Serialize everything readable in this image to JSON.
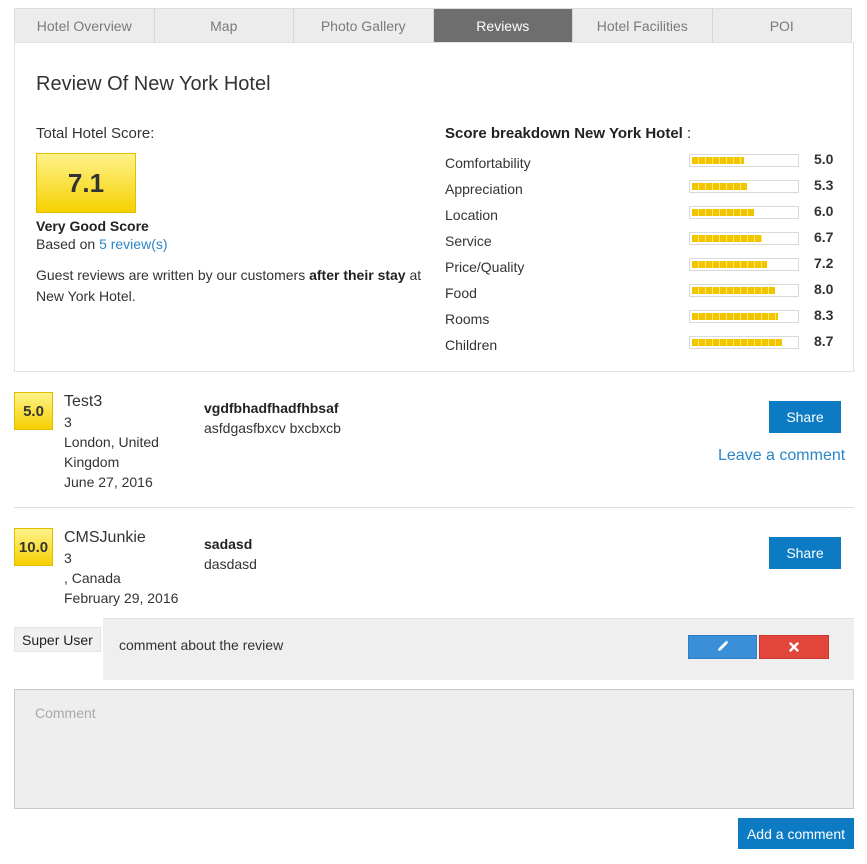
{
  "tabs": [
    {
      "label": "Hotel Overview",
      "active": false
    },
    {
      "label": "Map",
      "active": false
    },
    {
      "label": "Photo Gallery",
      "active": false
    },
    {
      "label": "Reviews",
      "active": true
    },
    {
      "label": "Hotel Facilities",
      "active": false
    },
    {
      "label": "POI",
      "active": false
    }
  ],
  "summary": {
    "title": "Review Of New York Hotel",
    "total_label": "Total Hotel Score:",
    "score": "7.1",
    "score_text": "Very Good Score",
    "based_on_prefix": "Based on",
    "based_on_link": "5 review(s)",
    "guest_note_pre": "Guest reviews are written by our customers",
    "guest_note_bold": "after their stay",
    "guest_note_post": "at New York Hotel."
  },
  "breakdown": {
    "title": "Score breakdown New York Hotel",
    "title_suffix": ":",
    "max_score": 10,
    "items": [
      {
        "label": "Comfortability",
        "value": "5.0"
      },
      {
        "label": "Appreciation",
        "value": "5.3"
      },
      {
        "label": "Location",
        "value": "6.0"
      },
      {
        "label": "Service",
        "value": "6.7"
      },
      {
        "label": "Price/Quality",
        "value": "7.2"
      },
      {
        "label": "Food",
        "value": "8.0"
      },
      {
        "label": "Rooms",
        "value": "8.3"
      },
      {
        "label": "Children",
        "value": "8.7"
      }
    ]
  },
  "reviews": [
    {
      "score": "5.0",
      "name": "Test3",
      "count": "3",
      "location": "London, United Kingdom",
      "date": "June 27, 2016",
      "title": "vgdfbhadfhadfhbsaf",
      "text": "asfdgasfbxcv bxcbxcb",
      "share_label": "Share",
      "leave_comment_label": "Leave a comment"
    },
    {
      "score": "10.0",
      "name": "CMSJunkie",
      "count": "3",
      "location": ", Canada",
      "date": "February 29, 2016",
      "title": "sadasd",
      "text": "dasdasd",
      "share_label": "Share"
    }
  ],
  "comment": {
    "author": "Super User",
    "text": "comment about the review",
    "edit_icon": "pencil-icon",
    "delete_icon": "close-icon"
  },
  "comment_form": {
    "placeholder": "Comment",
    "value": "",
    "submit_label": "Add a comment"
  },
  "colors": {
    "accent": "#0d7bc4",
    "score_yellow": "#f5d000",
    "active_tab": "#6e6e6e",
    "delete_red": "#e2463b",
    "edit_blue": "#3a8fd8"
  }
}
